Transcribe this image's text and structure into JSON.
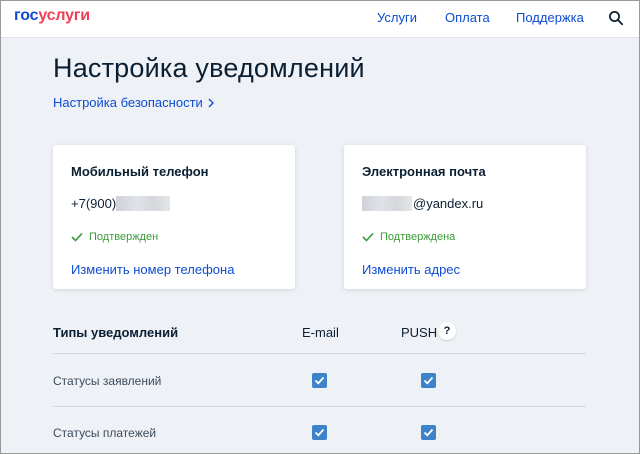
{
  "header": {
    "logo_part1": "гос",
    "logo_part2": "услуги",
    "nav": [
      "Услуги",
      "Оплата",
      "Поддержка"
    ],
    "search_icon": "search-icon"
  },
  "page": {
    "title": "Настройка уведомлений",
    "security_link": "Настройка безопасности"
  },
  "phone_card": {
    "title": "Мобильный телефон",
    "value_visible": "+7(900)",
    "status": "Подтвержден",
    "change_link": "Изменить номер телефона"
  },
  "email_card": {
    "title": "Электронная почта",
    "value_visible": "@yandex.ru",
    "status": "Подтверждена",
    "change_link": "Изменить адрес"
  },
  "notifications": {
    "header_type": "Типы уведомлений",
    "header_email": "E-mail",
    "header_push": "PUSH",
    "help": "?",
    "rows": [
      {
        "label": "Статусы заявлений",
        "email": true,
        "push": true
      },
      {
        "label": "Статусы платежей",
        "email": true,
        "push": true
      }
    ]
  },
  "colors": {
    "link": "#0d4cd3",
    "logo_red": "#ee3f58",
    "success": "#3a9b39",
    "checkbox": "#3d83c9",
    "background": "#eef1f5"
  }
}
